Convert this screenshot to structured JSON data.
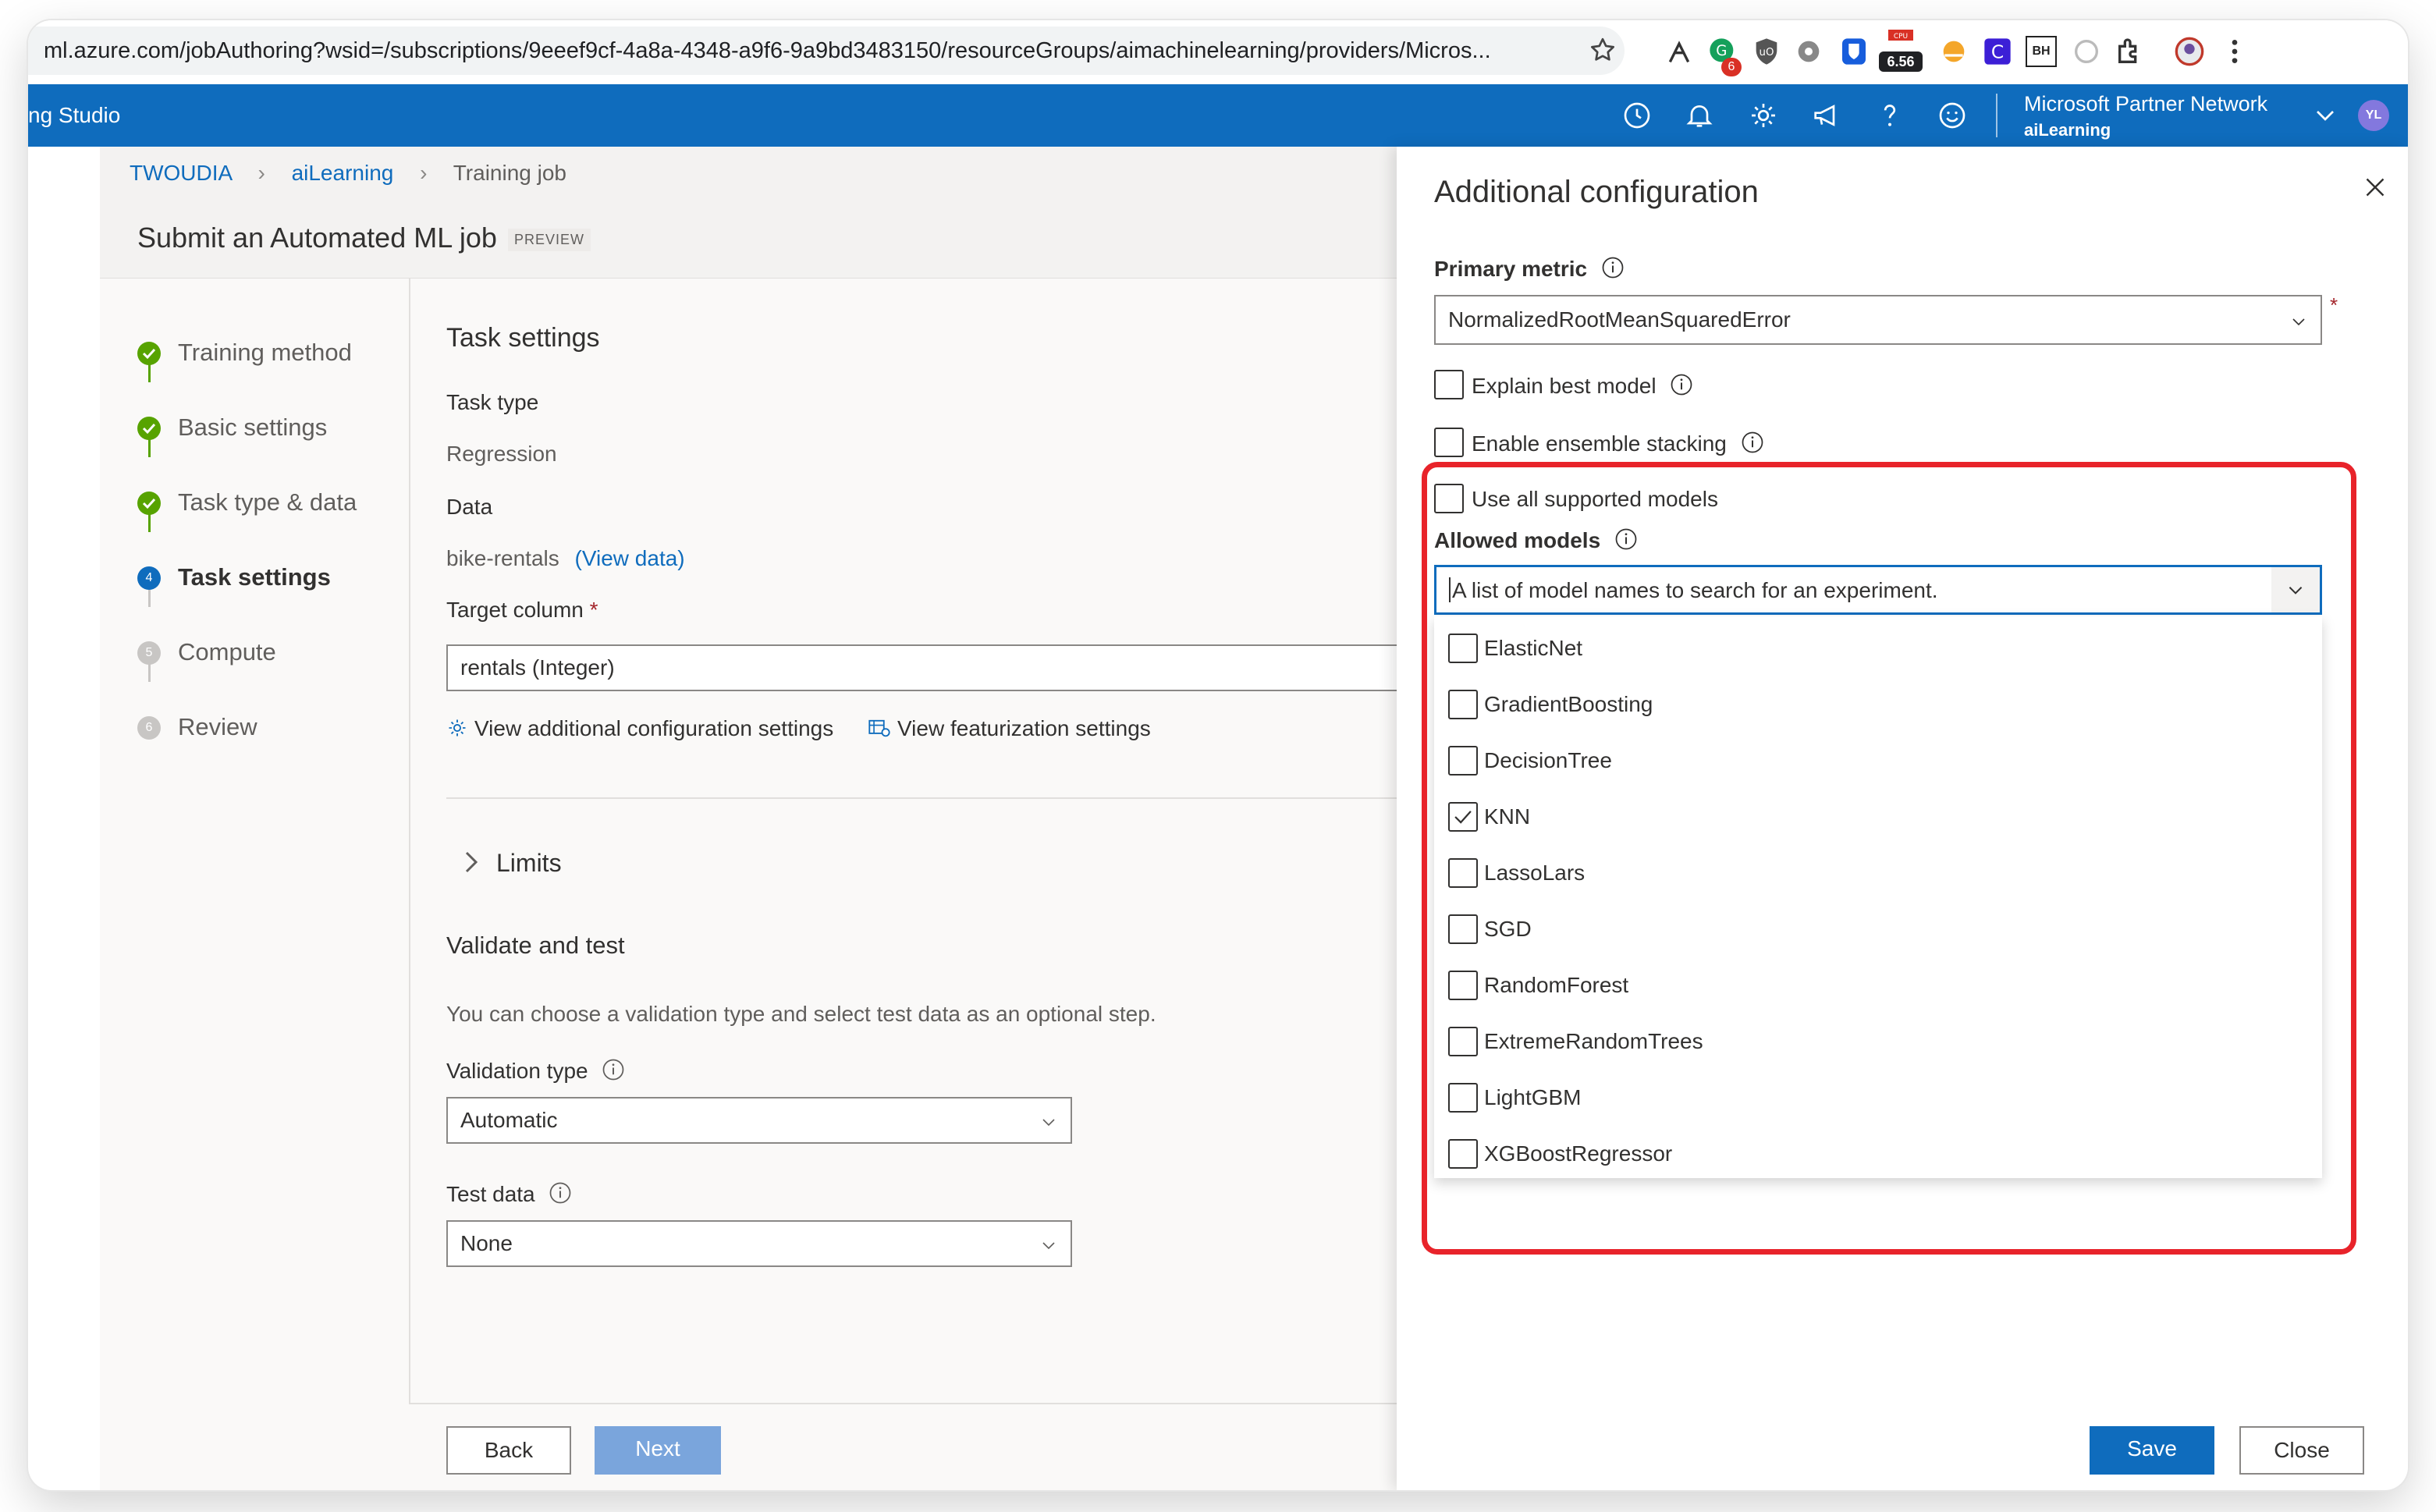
{
  "browser": {
    "url": "ml.azure.com/jobAuthoring?wsid=/subscriptions/9eeef9cf-4a8a-4348-a9f6-9a9bd3483150/resourceGroups/aimachinelearning/providers/Micros...",
    "extension_badge_count": "6",
    "extension_badge_value": "6.56",
    "extension_monogram": "BH"
  },
  "header": {
    "studio_name": "ng Studio",
    "partner_network": "Microsoft Partner Network",
    "workspace": "aiLearning",
    "avatar_initials": "YL",
    "accent_color": "#0f6cbd"
  },
  "breadcrumb": [
    "TWOUDIA",
    "aiLearning",
    "Training job"
  ],
  "page": {
    "title": "Submit an Automated ML job",
    "preview_badge": "PREVIEW"
  },
  "steps": [
    {
      "label": "Training method",
      "status": "done"
    },
    {
      "label": "Basic settings",
      "status": "done"
    },
    {
      "label": "Task type & data",
      "status": "done"
    },
    {
      "label": "Task settings",
      "status": "active",
      "number": "4"
    },
    {
      "label": "Compute",
      "status": "pending",
      "number": "5"
    },
    {
      "label": "Review",
      "status": "pending",
      "number": "6"
    }
  ],
  "task_settings": {
    "heading": "Task settings",
    "task_type_label": "Task type",
    "task_type_value": "Regression",
    "data_label": "Data",
    "data_value": "bike-rentals",
    "view_data_link": "(View data)",
    "target_column_label": "Target column",
    "required_marker": "*",
    "target_column_value": "rentals (Integer)",
    "view_additional_config": "View additional configuration settings",
    "view_featurization": "View featurization settings",
    "limits_label": "Limits",
    "validate_heading": "Validate and test",
    "validate_desc": "You can choose a validation type and select test data as an optional step.",
    "validation_type_label": "Validation type",
    "validation_type_value": "Automatic",
    "test_data_label": "Test data",
    "test_data_value": "None"
  },
  "footer": {
    "back_label": "Back",
    "next_label": "Next"
  },
  "panel": {
    "title": "Additional configuration",
    "primary_metric_label": "Primary metric",
    "primary_metric_value": "NormalizedRootMeanSquaredError",
    "required_marker": "*",
    "explain_best_model": "Explain best model",
    "enable_ensemble_stacking": "Enable ensemble stacking",
    "use_all_supported_models": "Use all supported models",
    "allowed_models_label": "Allowed models",
    "allowed_models_placeholder": "A list of model names to search for an experiment.",
    "models": [
      {
        "name": "ElasticNet",
        "checked": false
      },
      {
        "name": "GradientBoosting",
        "checked": false
      },
      {
        "name": "DecisionTree",
        "checked": false
      },
      {
        "name": "KNN",
        "checked": true
      },
      {
        "name": "LassoLars",
        "checked": false
      },
      {
        "name": "SGD",
        "checked": false
      },
      {
        "name": "RandomForest",
        "checked": false
      },
      {
        "name": "ExtremeRandomTrees",
        "checked": false
      },
      {
        "name": "LightGBM",
        "checked": false
      },
      {
        "name": "XGBoostRegressor",
        "checked": false
      }
    ],
    "save_label": "Save",
    "close_label": "Close",
    "highlight_color": "#e8232a"
  }
}
